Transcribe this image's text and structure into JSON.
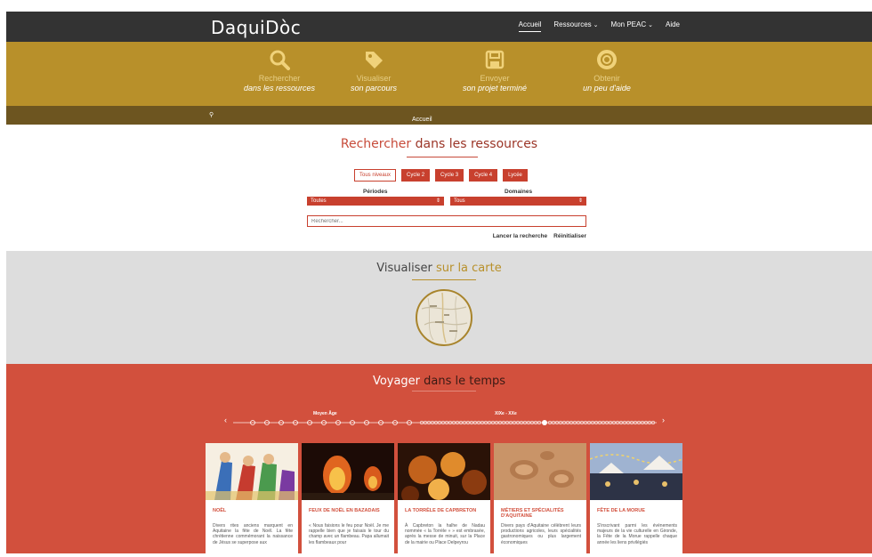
{
  "nav": {
    "logo": "DaquiDòc",
    "items": [
      {
        "label": "Accueil"
      },
      {
        "label": "Ressources"
      },
      {
        "label": "Mon PEAC"
      },
      {
        "label": "Aide"
      }
    ]
  },
  "hero": {
    "items": [
      {
        "line1": "Rechercher",
        "line2": "dans les ressources",
        "icon": "search-icon"
      },
      {
        "line1": "Visualiser",
        "line2": "son parcours",
        "icon": "tag-icon"
      },
      {
        "line1": "Envoyer",
        "line2": "son projet terminé",
        "icon": "save-icon"
      },
      {
        "line1": "Obtenir",
        "line2": "un peu d'aide",
        "icon": "lifebuoy-icon"
      }
    ]
  },
  "breadcrumb": {
    "home": "Accueil"
  },
  "search": {
    "title_a": "Rechercher",
    "title_b": "dans les ressources",
    "levels": [
      "Tous niveaux",
      "Cycle 2",
      "Cycle 3",
      "Cycle 4",
      "Lycée"
    ],
    "periods_label": "Périodes",
    "periods_value": "Toutes",
    "domains_label": "Domaines",
    "domains_value": "Tous",
    "placeholder": "Rechercher...",
    "submit_label": "Lancer la recherche",
    "reset_label": "Réinitialiser"
  },
  "map": {
    "title_a": "Visualiser",
    "title_b": "sur la carte"
  },
  "timeline": {
    "title_a": "Voyager",
    "title_b": "dans le temps",
    "label_a": "Moyen Âge",
    "label_b": "XIXe - XXe",
    "prev": "‹",
    "next": "›"
  },
  "cards": [
    {
      "title": "Noël",
      "text": "Divers rites anciens marquent en Aquitaine la fête de Noël. La fête chrétienne commémorant la naissance de Jésus se superpose aux"
    },
    {
      "title": "Feux de Noël en Bazadais",
      "text": "« Nous faisions le feu pour Noël. Je me rappelle bien que je faisais le tour du champ avec un flambeau. Papa allumait les flambeaux pour"
    },
    {
      "title": "La Torrèle de Capbreton",
      "text": "À Capbreton la halhe de Nadau nommée « la Torrèle » » est embrasée, après la messe de minuit, sur la Place de la mairie ou Place Delpeyrou"
    },
    {
      "title": "Métiers et spécialités d'Aquitaine",
      "text": "Divers pays d'Aquitaine célèbrent leurs productions agricoles, leurs spécialités gastronomiques ou plus largement économiques"
    },
    {
      "title": "Fête de la morue",
      "text": "S'inscrivant parmi les évènements majeurs de la vie culturelle en Gironde, la Fête de la Morue rappelle chaque année les liens privilégiés"
    }
  ],
  "colors": {
    "nav": "#333333",
    "gold": "#b8902a",
    "brown": "#6d5520",
    "red": "#d2503d",
    "grey": "#dddddd"
  }
}
